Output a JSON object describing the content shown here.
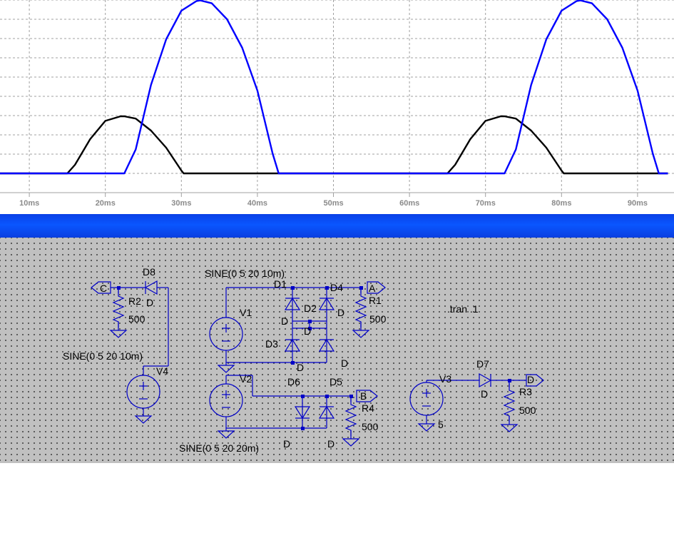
{
  "plot": {
    "x_ticks": [
      "10ms",
      "20ms",
      "30ms",
      "40ms",
      "50ms",
      "60ms",
      "70ms",
      "80ms",
      "90ms"
    ],
    "colors": {
      "trace_blue": "#0000ff",
      "trace_black": "#000000",
      "grid": "#a0a0a0"
    }
  },
  "chart_data": {
    "type": "line",
    "xlabel": "",
    "ylabel": "",
    "xlim": [
      5,
      94
    ],
    "x_ticks": [
      10,
      20,
      30,
      40,
      50,
      60,
      70,
      80,
      90
    ],
    "x_tick_labels": [
      "10ms",
      "20ms",
      "30ms",
      "40ms",
      "50ms",
      "60ms",
      "70ms",
      "80ms",
      "90ms"
    ],
    "x_unit": "ms",
    "grid": true,
    "series": [
      {
        "color": "#000000",
        "x": [
          0,
          15,
          16,
          18,
          20,
          22,
          22.5,
          24,
          26,
          28,
          30,
          30.3,
          50,
          65,
          66,
          68,
          70,
          72,
          72.5,
          74,
          76,
          78,
          80,
          80.3,
          94
        ],
        "y": [
          0,
          0,
          0.15,
          0.6,
          0.92,
          1.0,
          1.0,
          0.96,
          0.75,
          0.45,
          0.05,
          0,
          0,
          0,
          0.15,
          0.6,
          0.92,
          1.0,
          1.0,
          0.96,
          0.75,
          0.45,
          0.05,
          0,
          0
        ]
      },
      {
        "color": "#0000ff",
        "x": [
          0,
          22.5,
          24,
          26,
          28,
          30,
          32,
          32.5,
          34,
          36,
          38,
          40,
          42,
          42.8,
          72.5,
          74,
          76,
          78,
          80,
          82,
          82.5,
          84,
          86,
          88,
          90,
          92,
          92.8,
          94
        ],
        "y": [
          0,
          0,
          0.42,
          1.55,
          2.35,
          2.85,
          3.02,
          3.03,
          2.98,
          2.7,
          2.2,
          1.45,
          0.35,
          0,
          0,
          0.42,
          1.55,
          2.35,
          2.85,
          3.02,
          3.03,
          2.98,
          2.7,
          2.2,
          1.45,
          0.35,
          0,
          0
        ]
      }
    ]
  },
  "schematic": {
    "labels": {
      "d8": "D8",
      "d8_model": "D",
      "net_c": "C",
      "r2": "R2",
      "r2_val": "500",
      "v4_sine": "SINE(0 5 20 10m)",
      "v4": "V4",
      "v1_sine": "SINE(0 5 20 10m)",
      "v1": "V1",
      "d1": "D1",
      "d1_model": "D",
      "d4": "D4",
      "d4_model": "D",
      "d2": "D2",
      "d2_model": "D",
      "d3": "D3",
      "d3_model": "D",
      "d_right_model": "D",
      "net_a": "A",
      "r1": "R1",
      "r1_val": "500",
      "tran": ".tran .1",
      "v2": "V2",
      "d6": "D6",
      "d5": "D5",
      "net_b": "B",
      "r4": "R4",
      "r4_val": "500",
      "v2_sine": "SINE(0 5 20 20m)",
      "d6_model": "D",
      "d5_model": "D",
      "v3": "V3",
      "v3_val": "5",
      "d7": "D7",
      "d7_model": "D",
      "net_d": "D",
      "r3": "R3",
      "r3_val": "500"
    }
  }
}
